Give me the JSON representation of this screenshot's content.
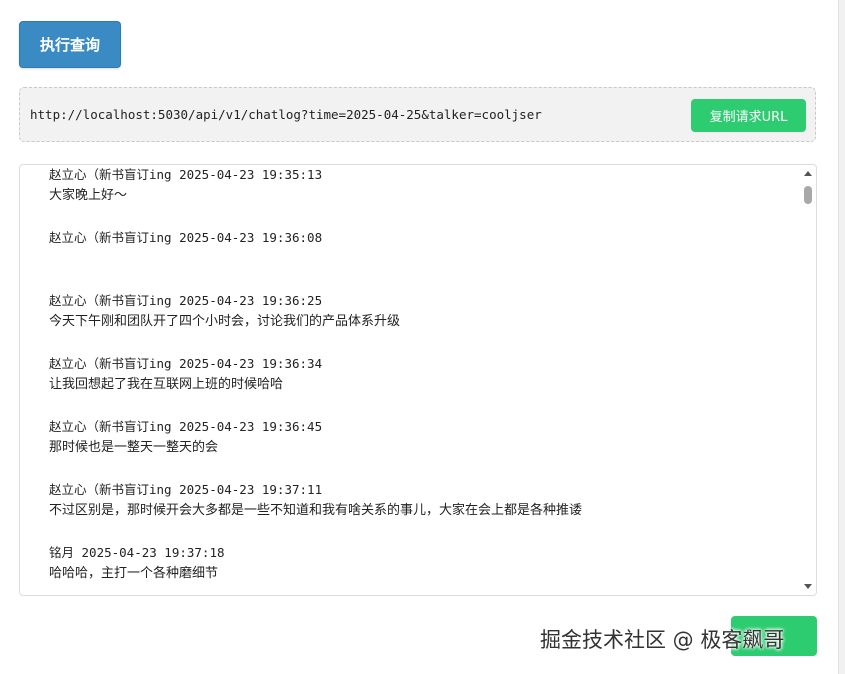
{
  "toolbar": {
    "execute_label": "执行查询"
  },
  "request": {
    "url": "http://localhost:5030/api/v1/chatlog?time=2025-04-25&talker=cooljser",
    "copy_label": "复制请求URL"
  },
  "chatlog": {
    "messages": [
      {
        "header": "赵立心（新书盲订ing 2025-04-23 19:35:13",
        "text": "大家晚上好～"
      },
      {
        "header": "赵立心（新书盲订ing 2025-04-23 19:36:08",
        "text": ""
      },
      {
        "header": "赵立心（新书盲订ing 2025-04-23 19:36:25",
        "text": "今天下午刚和团队开了四个小时会，讨论我们的产品体系升级"
      },
      {
        "header": "赵立心（新书盲订ing 2025-04-23 19:36:34",
        "text": "让我回想起了我在互联网上班的时候哈哈"
      },
      {
        "header": "赵立心（新书盲订ing 2025-04-23 19:36:45",
        "text": "那时候也是一整天一整天的会"
      },
      {
        "header": "赵立心（新书盲订ing 2025-04-23 19:37:11",
        "text": "不过区别是，那时候开会大多都是一些不知道和我有啥关系的事儿，大家在会上都是各种推诿"
      },
      {
        "header": "铭月 2025-04-23 19:37:18",
        "text": "哈哈哈，主打一个各种磨细节"
      }
    ]
  },
  "watermark": {
    "text": "掘金技术社区 @ 极客飙哥"
  },
  "colors": {
    "primary": "#3a8bc4",
    "success": "#2ecc71"
  }
}
